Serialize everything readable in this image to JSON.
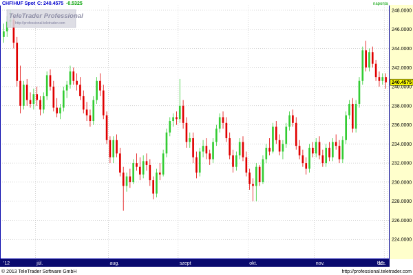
{
  "header": {
    "symbol": "CHF/HUF Spot",
    "last_label": "C:",
    "last_value": "240.4575",
    "change": "-0.5325",
    "interval": "naponta"
  },
  "logo": {
    "brand": "TeleTrader Professional",
    "url": "http://professional.teletrader.com"
  },
  "footer": {
    "copyright": "© 2013 TeleTrader Software GmbH",
    "url": "http://professional.teletrader.com"
  },
  "colors": {
    "up": "#33cc33",
    "down": "#e00000",
    "plot_border": "#0000aa",
    "price_axis_bg": "#ffffcc",
    "time_axis_bg": "#0a0a6e",
    "marker_bg": "#ffff00"
  },
  "chart_data": {
    "type": "candlestick",
    "title": "CHF/HUF Spot",
    "ylim": [
      222.0,
      248.5
    ],
    "y_ticks": [
      "224.0000",
      "226.0000",
      "228.0000",
      "230.0000",
      "232.0000",
      "234.0000",
      "236.0000",
      "238.0000",
      "240.0000",
      "242.0000",
      "244.0000",
      "246.0000",
      "248.0000"
    ],
    "last_price": "240.4575",
    "x_ticks": [
      "'12",
      "júl.",
      "aug.",
      "szept",
      "okt.",
      "nov.",
      "dec.",
      "'13"
    ],
    "grid": true,
    "candles": [
      [
        245.2,
        246.6,
        244.6,
        245.8
      ],
      [
        245.8,
        247.4,
        245.2,
        246.8
      ],
      [
        246.8,
        248.0,
        246.2,
        247.0
      ],
      [
        247.0,
        247.6,
        244.0,
        244.6
      ],
      [
        244.6,
        245.2,
        240.0,
        240.6
      ],
      [
        240.6,
        242.2,
        237.2,
        238.0
      ],
      [
        238.0,
        240.6,
        237.6,
        240.2
      ],
      [
        240.2,
        240.8,
        238.0,
        238.6
      ],
      [
        238.6,
        239.4,
        237.8,
        238.2
      ],
      [
        238.2,
        239.8,
        237.6,
        239.2
      ],
      [
        239.2,
        240.0,
        238.0,
        238.6
      ],
      [
        238.6,
        239.0,
        237.0,
        237.6
      ],
      [
        237.6,
        239.4,
        237.2,
        239.0
      ],
      [
        239.0,
        241.6,
        238.6,
        241.2
      ],
      [
        241.2,
        241.8,
        239.6,
        240.0
      ],
      [
        240.0,
        240.6,
        237.4,
        237.8
      ],
      [
        237.8,
        238.8,
        236.8,
        237.2
      ],
      [
        237.2,
        238.2,
        236.6,
        237.8
      ],
      [
        237.8,
        240.0,
        237.4,
        239.6
      ],
      [
        239.6,
        240.6,
        238.8,
        240.2
      ],
      [
        240.2,
        242.2,
        239.8,
        241.6
      ],
      [
        241.6,
        242.0,
        240.2,
        240.6
      ],
      [
        240.6,
        241.4,
        239.6,
        240.2
      ],
      [
        240.2,
        241.0,
        238.6,
        239.0
      ],
      [
        239.0,
        239.6,
        237.2,
        237.6
      ],
      [
        237.6,
        238.4,
        236.4,
        237.0
      ],
      [
        237.0,
        237.6,
        235.8,
        236.4
      ],
      [
        236.4,
        239.0,
        236.0,
        238.6
      ],
      [
        238.6,
        241.0,
        238.2,
        240.6
      ],
      [
        240.6,
        241.4,
        239.0,
        239.6
      ],
      [
        239.6,
        240.2,
        236.6,
        237.0
      ],
      [
        237.0,
        237.4,
        234.0,
        234.4
      ],
      [
        234.4,
        234.8,
        232.0,
        232.6
      ],
      [
        232.6,
        234.8,
        232.0,
        234.4
      ],
      [
        234.4,
        235.0,
        232.6,
        233.0
      ],
      [
        233.0,
        233.6,
        230.6,
        231.0
      ],
      [
        231.0,
        231.6,
        227.0,
        229.6
      ],
      [
        229.6,
        231.0,
        229.0,
        230.6
      ],
      [
        230.6,
        231.4,
        229.4,
        230.0
      ],
      [
        230.0,
        232.4,
        229.8,
        232.0
      ],
      [
        232.0,
        233.0,
        231.2,
        231.6
      ],
      [
        231.6,
        232.6,
        230.2,
        230.8
      ],
      [
        230.8,
        232.8,
        230.4,
        232.2
      ],
      [
        232.2,
        233.0,
        231.2,
        231.8
      ],
      [
        231.8,
        232.4,
        229.6,
        230.2
      ],
      [
        230.2,
        230.6,
        228.2,
        228.8
      ],
      [
        228.8,
        231.4,
        228.4,
        231.0
      ],
      [
        231.0,
        232.0,
        230.2,
        230.8
      ],
      [
        230.8,
        233.4,
        230.6,
        233.0
      ],
      [
        233.0,
        235.6,
        232.6,
        235.2
      ],
      [
        235.2,
        236.8,
        234.8,
        236.4
      ],
      [
        236.4,
        237.2,
        235.8,
        236.8
      ],
      [
        236.8,
        237.4,
        236.0,
        236.6
      ],
      [
        236.6,
        240.8,
        236.2,
        238.0
      ],
      [
        238.0,
        238.6,
        235.6,
        236.2
      ],
      [
        236.2,
        236.8,
        233.6,
        234.2
      ],
      [
        234.2,
        235.2,
        233.6,
        234.6
      ],
      [
        234.6,
        235.2,
        232.0,
        232.6
      ],
      [
        232.6,
        233.2,
        230.4,
        231.0
      ],
      [
        231.0,
        233.6,
        230.6,
        233.2
      ],
      [
        233.2,
        234.4,
        232.6,
        233.8
      ],
      [
        233.8,
        234.6,
        232.4,
        233.0
      ],
      [
        233.0,
        233.4,
        231.8,
        232.4
      ],
      [
        232.4,
        234.6,
        232.0,
        234.2
      ],
      [
        234.2,
        236.0,
        233.8,
        235.6
      ],
      [
        235.6,
        237.2,
        235.2,
        236.8
      ],
      [
        236.8,
        237.4,
        235.6,
        236.2
      ],
      [
        236.2,
        236.8,
        234.2,
        234.6
      ],
      [
        234.6,
        235.2,
        232.4,
        232.8
      ],
      [
        232.8,
        233.4,
        231.0,
        231.6
      ],
      [
        231.6,
        233.2,
        231.2,
        232.8
      ],
      [
        232.8,
        234.6,
        232.4,
        234.2
      ],
      [
        234.2,
        234.8,
        232.2,
        232.6
      ],
      [
        232.6,
        233.2,
        230.6,
        231.0
      ],
      [
        231.0,
        231.4,
        229.2,
        229.8
      ],
      [
        229.8,
        230.4,
        228.0,
        229.6
      ],
      [
        229.6,
        232.0,
        228.0,
        231.6
      ],
      [
        231.6,
        231.8,
        229.6,
        230.0
      ],
      [
        230.0,
        232.8,
        229.8,
        232.4
      ],
      [
        232.4,
        234.0,
        232.0,
        233.6
      ],
      [
        233.6,
        234.6,
        232.8,
        233.2
      ],
      [
        233.2,
        236.2,
        233.0,
        235.8
      ],
      [
        235.8,
        236.4,
        234.0,
        234.4
      ],
      [
        234.4,
        235.0,
        232.8,
        233.2
      ],
      [
        233.2,
        234.4,
        232.4,
        234.0
      ],
      [
        234.0,
        236.2,
        233.6,
        235.8
      ],
      [
        235.8,
        237.4,
        235.4,
        237.0
      ],
      [
        237.0,
        237.6,
        235.8,
        236.2
      ],
      [
        236.2,
        236.8,
        233.4,
        233.8
      ],
      [
        233.8,
        234.4,
        232.4,
        232.8
      ],
      [
        232.8,
        233.4,
        231.6,
        232.0
      ],
      [
        232.0,
        232.6,
        230.8,
        231.4
      ],
      [
        231.4,
        234.0,
        231.0,
        233.6
      ],
      [
        233.6,
        234.2,
        232.6,
        233.0
      ],
      [
        233.0,
        234.6,
        232.6,
        234.2
      ],
      [
        234.2,
        234.8,
        232.4,
        232.8
      ],
      [
        232.8,
        233.4,
        231.6,
        232.0
      ],
      [
        232.0,
        234.0,
        231.6,
        233.6
      ],
      [
        233.6,
        234.2,
        232.2,
        232.6
      ],
      [
        232.6,
        234.6,
        232.2,
        234.2
      ],
      [
        234.2,
        235.0,
        233.4,
        233.8
      ],
      [
        233.8,
        234.4,
        232.0,
        232.4
      ],
      [
        232.4,
        234.8,
        232.0,
        234.4
      ],
      [
        234.4,
        237.4,
        234.0,
        237.0
      ],
      [
        237.0,
        238.6,
        236.6,
        238.2
      ],
      [
        238.2,
        238.8,
        235.2,
        235.6
      ],
      [
        235.6,
        238.6,
        235.2,
        238.2
      ],
      [
        238.2,
        241.0,
        237.8,
        240.6
      ],
      [
        240.6,
        244.2,
        240.2,
        243.8
      ],
      [
        243.8,
        244.8,
        241.6,
        242.0
      ],
      [
        242.0,
        244.0,
        241.6,
        243.6
      ],
      [
        243.6,
        244.2,
        242.0,
        242.4
      ],
      [
        242.4,
        242.8,
        240.6,
        241.0
      ],
      [
        241.0,
        241.6,
        240.0,
        240.6
      ],
      [
        240.6,
        241.4,
        240.2,
        241.0
      ],
      [
        241.0,
        241.4,
        239.8,
        240.4575
      ]
    ]
  }
}
